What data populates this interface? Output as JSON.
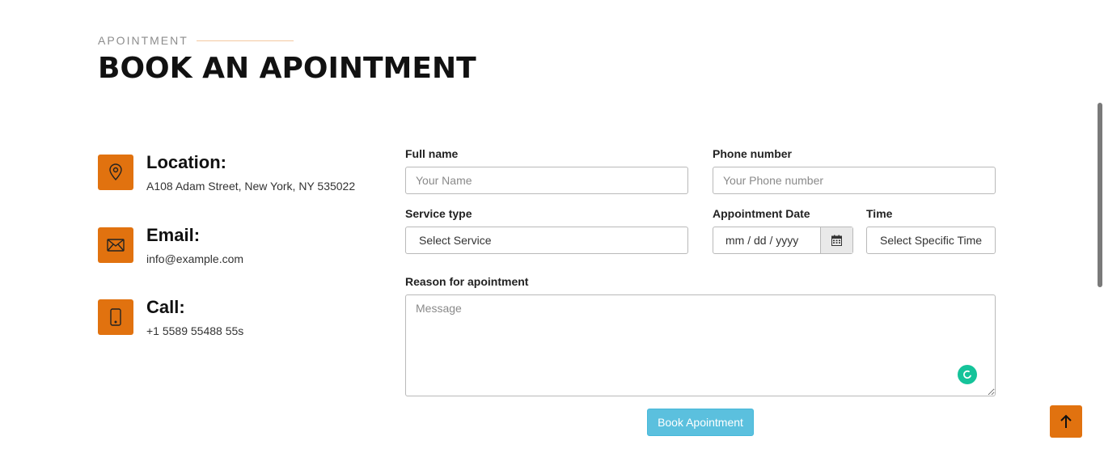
{
  "section": {
    "eyebrow": "APOINTMENT",
    "title": "BOOK AN APOINTMENT"
  },
  "contact": [
    {
      "icon": "map-pin-icon",
      "title": "Location:",
      "value": "A108 Adam Street, New York, NY 535022"
    },
    {
      "icon": "envelope-icon",
      "title": "Email:",
      "value": "info@example.com"
    },
    {
      "icon": "phone-icon",
      "title": "Call:",
      "value": "+1 5589 55488 55s"
    }
  ],
  "form": {
    "full_name": {
      "label": "Full name",
      "placeholder": "Your Name",
      "value": ""
    },
    "phone": {
      "label": "Phone number",
      "placeholder": "Your Phone number",
      "value": ""
    },
    "service": {
      "label": "Service type",
      "selected": "Select Service"
    },
    "date": {
      "label": "Appointment Date",
      "value": "mm / dd / yyyy",
      "icon": "calendar-icon"
    },
    "time": {
      "label": "Time",
      "selected": "Select Specific Time"
    },
    "reason": {
      "label": "Reason for apointment",
      "placeholder": "Message",
      "value": ""
    },
    "submit_label": "Book Apointment"
  },
  "colors": {
    "accent": "#e1720f",
    "button": "#5bc0de",
    "grammarly": "#15c39a"
  },
  "floating": {
    "back_to_top_icon": "arrow-up-icon",
    "assistant_icon": "grammarly-icon"
  }
}
